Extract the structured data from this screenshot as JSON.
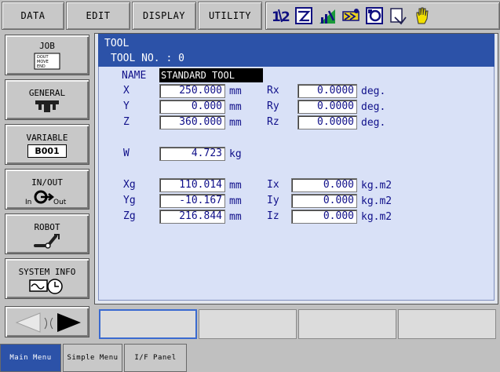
{
  "top_menu": [
    "DATA",
    "EDIT",
    "DISPLAY",
    "UTILITY"
  ],
  "status_icons": [
    "coordinate-toggle-icon",
    "edit-mode-icon",
    "speed-level-icon",
    "run-mode-icon",
    "teach-mode-icon",
    "cycle-icon",
    "hand-enable-icon"
  ],
  "side_menu": {
    "job": {
      "label": "JOB",
      "icon_text": [
        "DOUT",
        "MOVE",
        "END"
      ]
    },
    "general": {
      "label": "GENERAL"
    },
    "variable": {
      "label": "VARIABLE",
      "icon_text": "B001"
    },
    "inout": {
      "label": "IN/OUT",
      "icon_in": "In",
      "icon_out": "Out"
    },
    "robot": {
      "label": "ROBOT"
    },
    "system_info": {
      "label": "SYSTEM INFO"
    }
  },
  "panel": {
    "title": "TOOL",
    "tool_no_label": "TOOL NO.",
    "tool_no_value": ": 0",
    "name_label": "NAME",
    "name_value": "STANDARD TOOL",
    "position": [
      {
        "label": "X",
        "value": "250.000",
        "unit": "mm",
        "rot_label": "Rx",
        "rot_value": "0.0000",
        "rot_unit": "deg."
      },
      {
        "label": "Y",
        "value": "0.000",
        "unit": "mm",
        "rot_label": "Ry",
        "rot_value": "0.0000",
        "rot_unit": "deg."
      },
      {
        "label": "Z",
        "value": "360.000",
        "unit": "mm",
        "rot_label": "Rz",
        "rot_value": "0.0000",
        "rot_unit": "deg."
      }
    ],
    "weight": {
      "label": "W",
      "value": "4.723",
      "unit": "kg"
    },
    "center_of_gravity": [
      {
        "label": "Xg",
        "value": "110.014",
        "unit": "mm",
        "inertia_label": "Ix",
        "inertia_value": "0.000",
        "inertia_unit": "kg.m2"
      },
      {
        "label": "Yg",
        "value": "-10.167",
        "unit": "mm",
        "inertia_label": "Iy",
        "inertia_value": "0.000",
        "inertia_unit": "kg.m2"
      },
      {
        "label": "Zg",
        "value": "216.844",
        "unit": "mm",
        "inertia_label": "Iz",
        "inertia_value": "0.000",
        "inertia_unit": "kg.m2"
      }
    ]
  },
  "bottom_tabs": [
    "Main Menu",
    "Simple Menu",
    "I/F Panel"
  ],
  "colors": {
    "title_bar": "#2c52a8",
    "panel_bg": "#d9e1f7",
    "text": "#10108a",
    "active_tab": "#2c52a8"
  }
}
